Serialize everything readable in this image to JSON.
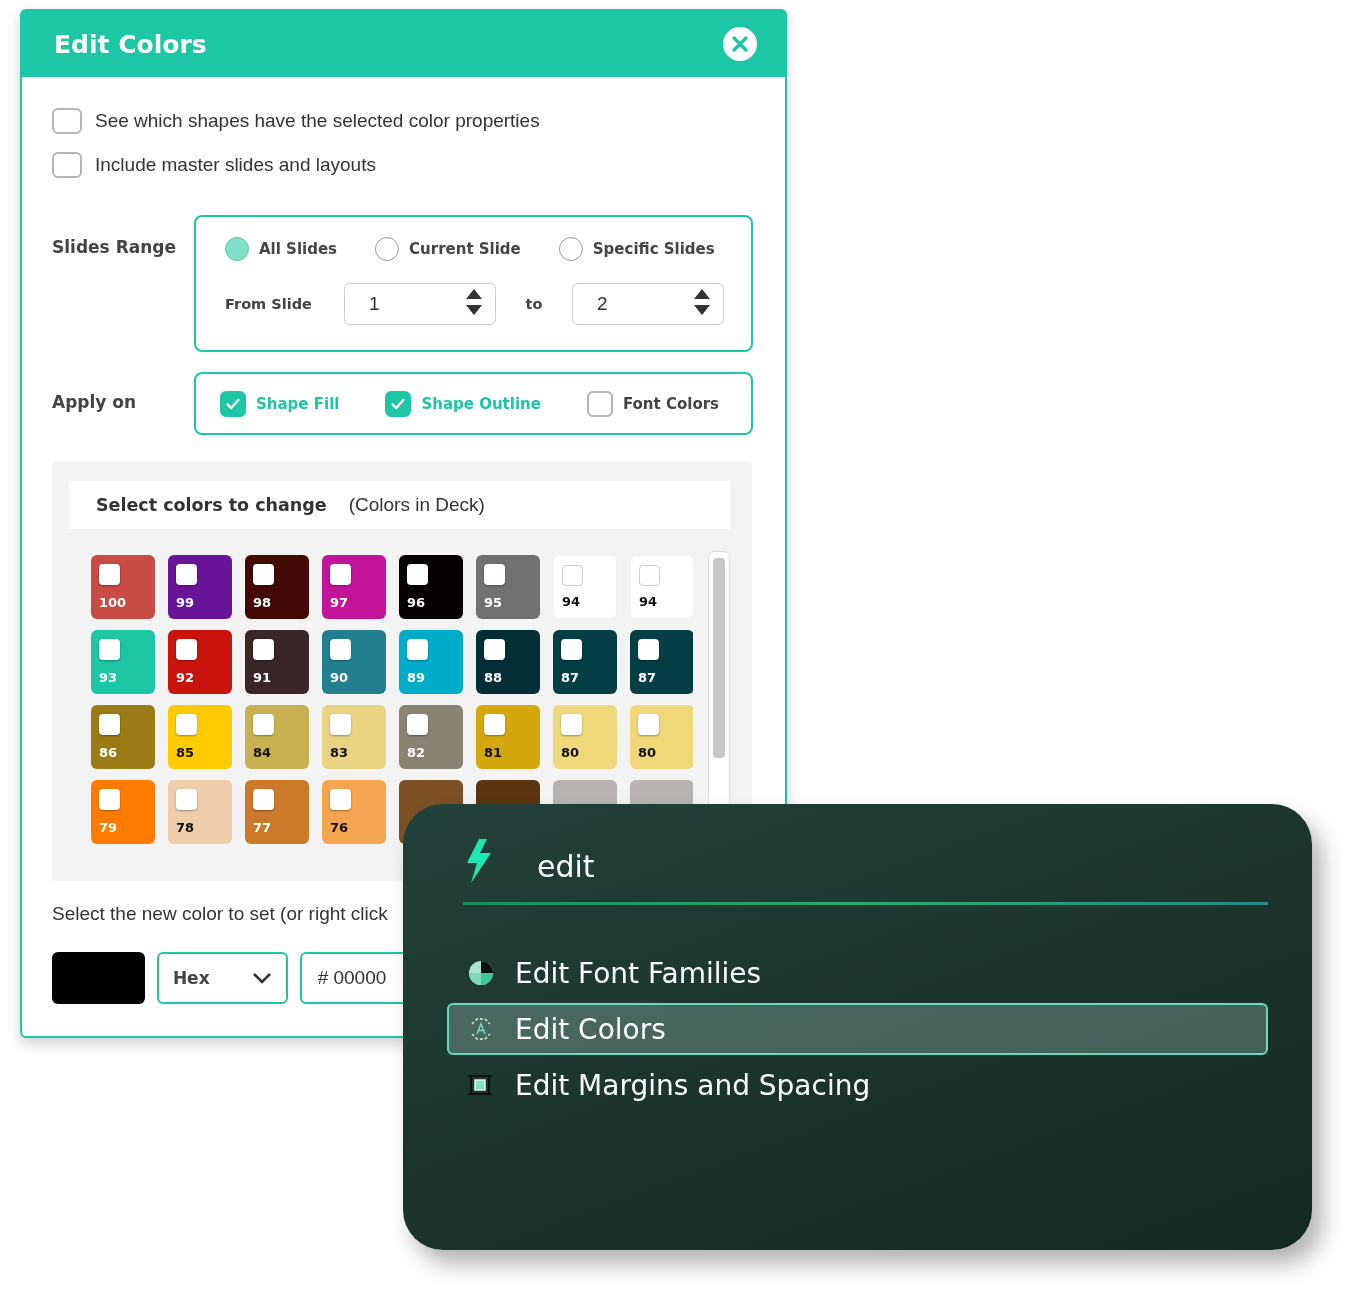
{
  "dialog": {
    "title": "Edit Colors",
    "options": [
      {
        "label": "See which shapes have the selected color properties",
        "checked": false
      },
      {
        "label": "Include master slides and layouts",
        "checked": false
      }
    ],
    "slides_range": {
      "label": "Slides Range",
      "choices": [
        {
          "label": "All Slides",
          "selected": true
        },
        {
          "label": "Current Slide",
          "selected": false
        },
        {
          "label": "Specific Slides",
          "selected": false
        }
      ],
      "from_label": "From Slide",
      "from_value": "1",
      "to_label": "to",
      "to_value": "2"
    },
    "apply_on": {
      "label": "Apply on",
      "choices": [
        {
          "label": "Shape Fill",
          "checked": true
        },
        {
          "label": "Shape Outline",
          "checked": true
        },
        {
          "label": "Font Colors",
          "checked": false
        }
      ]
    },
    "colors_panel": {
      "title": "Select colors to change",
      "subtitle": "(Colors in Deck)",
      "swatches": [
        {
          "label": "100",
          "color": "#c84b45",
          "checked": false
        },
        {
          "label": "99",
          "color": "#6a1497",
          "checked": false
        },
        {
          "label": "98",
          "color": "#420905",
          "checked": false
        },
        {
          "label": "97",
          "color": "#c2149a",
          "checked": false
        },
        {
          "label": "96",
          "color": "#070000",
          "checked": false
        },
        {
          "label": "95",
          "color": "#727070",
          "checked": false
        },
        {
          "label": "94",
          "color": "#ffffff",
          "checked": false
        },
        {
          "label": "94",
          "color": "#ffffff",
          "checked": false
        },
        {
          "label": "93",
          "color": "#1dc6a4",
          "checked": false
        },
        {
          "label": "92",
          "color": "#c8140c",
          "checked": false
        },
        {
          "label": "91",
          "color": "#3a2626",
          "checked": false
        },
        {
          "label": "90",
          "color": "#22808e",
          "checked": false
        },
        {
          "label": "89",
          "color": "#00acc7",
          "checked": false
        },
        {
          "label": "88",
          "color": "#032e35",
          "checked": false
        },
        {
          "label": "87",
          "color": "#063e46",
          "checked": false
        },
        {
          "label": "87",
          "color": "#063e46",
          "checked": false
        },
        {
          "label": "86",
          "color": "#9a7b15",
          "checked": false
        },
        {
          "label": "85",
          "color": "#ffcb00",
          "checked": false
        },
        {
          "label": "84",
          "color": "#c9b153",
          "checked": false
        },
        {
          "label": "83",
          "color": "#e9d484",
          "checked": false
        },
        {
          "label": "82",
          "color": "#888373",
          "checked": false
        },
        {
          "label": "81",
          "color": "#d4a80c",
          "checked": false
        },
        {
          "label": "80",
          "color": "#f0d77a",
          "checked": false
        },
        {
          "label": "80",
          "color": "#f0d77a",
          "checked": false
        },
        {
          "label": "79",
          "color": "#ff7c00",
          "checked": false
        },
        {
          "label": "78",
          "color": "#efcdab",
          "checked": false
        },
        {
          "label": "77",
          "color": "#cc7a2a",
          "checked": false
        },
        {
          "label": "76",
          "color": "#f5a450",
          "checked": false
        },
        {
          "color": "#7c5025"
        },
        {
          "color": "#5a3510"
        },
        {
          "color": "#b8b2b0"
        },
        {
          "color": "#b8b2b0"
        }
      ]
    },
    "new_color": {
      "instruction": "Select the new color to set  (or right click",
      "preview": {
        "color": "#000000"
      },
      "format": "Hex",
      "value": "# 00000"
    }
  },
  "command_menu": {
    "query": "edit",
    "items": [
      {
        "label": "Edit Font Families",
        "kind": "pie",
        "selected": false
      },
      {
        "label": "Edit Colors",
        "kind": "text-frame",
        "selected": true
      },
      {
        "label": "Edit Margins and Spacing",
        "kind": "margins",
        "selected": false
      }
    ]
  }
}
